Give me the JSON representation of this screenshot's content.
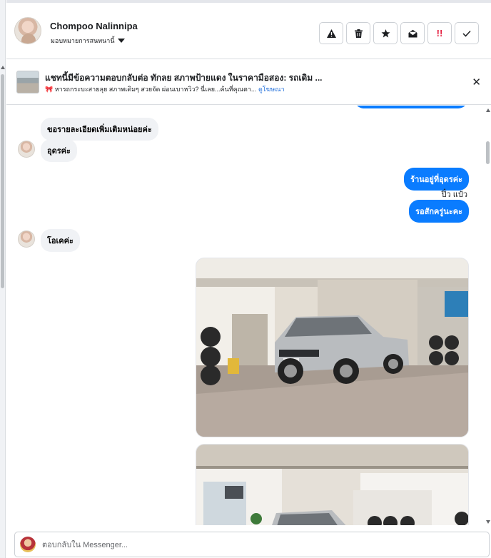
{
  "header": {
    "contact_name": "Chompoo Nalinnipa",
    "assign_label": "มอบหมายการสนทนานี้",
    "actions": [
      {
        "name": "spam-button",
        "icon": "warning-icon",
        "glyph": "⚠"
      },
      {
        "name": "delete-button",
        "icon": "trash-icon",
        "glyph": "🗑"
      },
      {
        "name": "star-button",
        "icon": "star-icon",
        "glyph": "★"
      },
      {
        "name": "mark-unread-button",
        "icon": "envelope-open-icon",
        "glyph": "✉"
      },
      {
        "name": "follow-up-button",
        "icon": "double-exclamation-icon",
        "glyph": "!!"
      },
      {
        "name": "done-button",
        "icon": "check-icon",
        "glyph": "✓"
      }
    ]
  },
  "ad": {
    "title": "แชทนี้มีข้อความตอบกลับต่อ ทักลย สภาพป้ายแดง ในราคามือสอง: รถเดิม ...",
    "sub_icon": "🎀",
    "subtitle": "หารถกระบะสายลุย สภาพเดิมๆ สวยจัด ผ่อนเบาหวิว? นี่เลย...ค้นที่คุณตา...",
    "link": "ดูโฆษณา",
    "close_glyph": "✕"
  },
  "messages": [
    {
      "side": "in",
      "text": "ขอรายละเอียดเพิ่มเติมหน่อยค่ะ"
    },
    {
      "side": "in",
      "text": "อุดรค่ะ"
    },
    {
      "side": "out",
      "text": "ร้านอยู่ที่อุดรค่ะ"
    },
    {
      "side": "out_sender",
      "text": "ปิ๋ว แป๋ว"
    },
    {
      "side": "out",
      "text": "รอสักครู่นะคะ"
    },
    {
      "side": "in",
      "text": "โอเคค่ะ"
    }
  ],
  "composer": {
    "placeholder": "ตอบกลับใน Messenger..."
  },
  "colors": {
    "outgoing_bubble": "#0a7cff",
    "incoming_bubble": "#f0f2f5",
    "follow_up_red": "#e41e3f",
    "link_blue": "#216fdb"
  }
}
